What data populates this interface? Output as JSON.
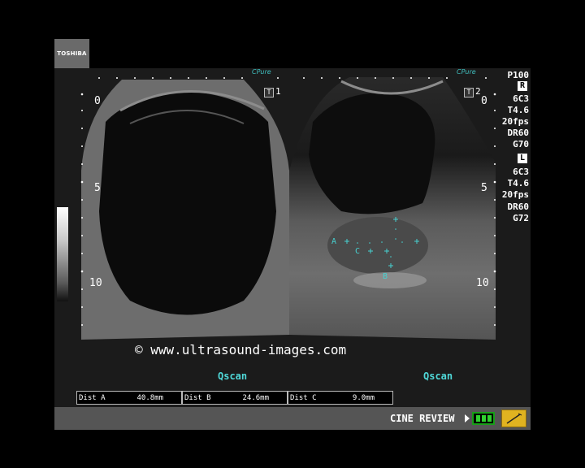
{
  "branding": {
    "logo_text": "TOSHIBA"
  },
  "watermark": "© www.ultrasound-images.com",
  "left_image": {
    "frame_label": "1",
    "probe_mark": "CPure",
    "depth_scale": [
      "0",
      "5",
      "10"
    ],
    "mode_label": "Qscan"
  },
  "right_image": {
    "frame_label": "2",
    "probe_mark": "CPure",
    "depth_scale": [
      "0",
      "5",
      "10"
    ],
    "mode_label": "Qscan",
    "caliper_labels": [
      "A",
      "C",
      "B"
    ]
  },
  "parameters": {
    "power": "P100",
    "right_section": {
      "marker": "R",
      "probe": "6C3",
      "tissue": "T4.6",
      "frame_rate": "20fps",
      "dynamic_range": "DR60",
      "gain": "G70"
    },
    "left_section": {
      "marker": "L",
      "probe": "6C3",
      "tissue": "T4.6",
      "frame_rate": "20fps",
      "dynamic_range": "DR60",
      "gain": "G72"
    }
  },
  "measurements": [
    {
      "name": "Dist A",
      "value": "40.8mm"
    },
    {
      "name": "Dist B",
      "value": "24.6mm"
    },
    {
      "name": "Dist C",
      "value": "9.0mm"
    }
  ],
  "status": {
    "cine_label": "CINE REVIEW"
  },
  "icons": {
    "play": "play-icon",
    "battery": "battery-icon",
    "pen": "pen-icon"
  },
  "colors": {
    "annotation_cyan": "#47d0d0",
    "status_bar": "#555555",
    "pen_yellow": "#e0b320"
  }
}
